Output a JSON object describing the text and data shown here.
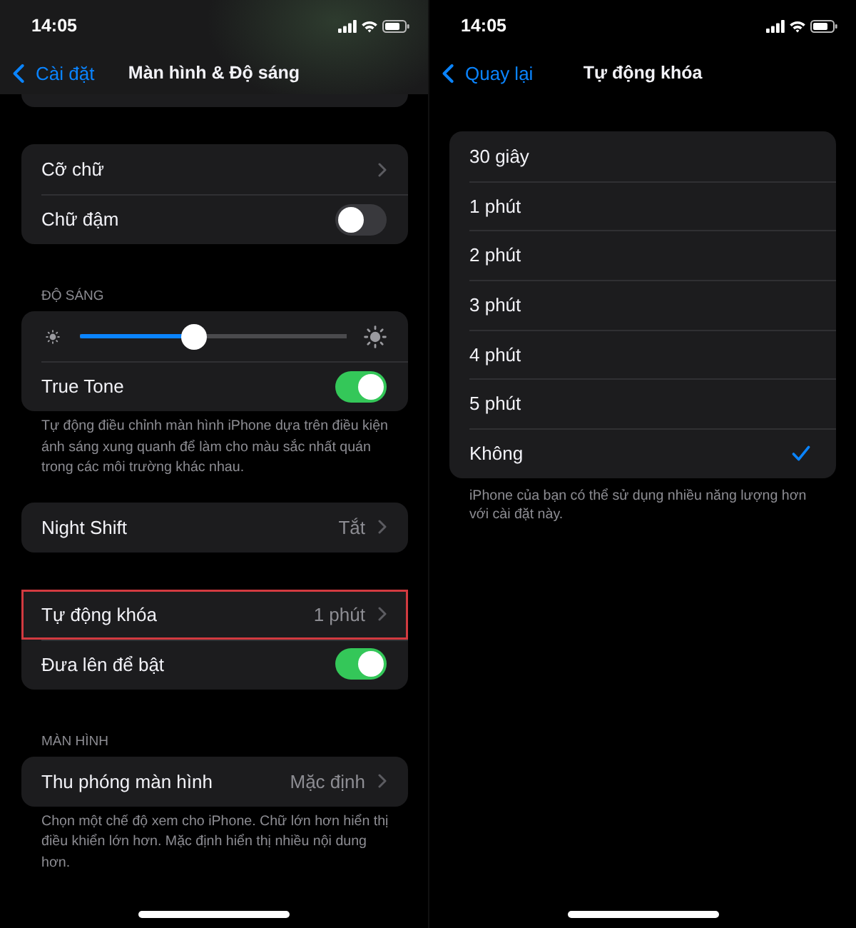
{
  "screens": [
    {
      "scrolled": true,
      "status_bar": {
        "time": "14:05"
      },
      "nav": {
        "back": "Cài đặt",
        "title": "Màn hình & Độ sáng"
      },
      "groups": [
        {
          "rows": [
            {
              "kind": "link",
              "label": "Cỡ chữ",
              "highlighted": false
            },
            {
              "kind": "toggle",
              "label": "Chữ đậm",
              "on": false,
              "highlighted": false
            }
          ]
        },
        {
          "header": "ĐỘ SÁNG",
          "rows": [
            {
              "kind": "slider",
              "level": 0.43,
              "highlighted": false
            },
            {
              "kind": "toggle",
              "label": "True Tone",
              "on": true,
              "highlighted": false
            }
          ],
          "footer": "Tự động điều chỉnh màn hình iPhone dựa trên điều kiện ánh sáng xung quanh để làm cho màu sắc nhất quán trong các môi trường khác nhau."
        },
        {
          "rows": [
            {
              "kind": "link",
              "label": "Night Shift",
              "value": "Tắt",
              "highlighted": false
            }
          ]
        },
        {
          "rows": [
            {
              "kind": "link",
              "label": "Tự động khóa",
              "value": "1 phút",
              "highlighted": true
            },
            {
              "kind": "toggle",
              "label": "Đưa lên để bật",
              "on": true,
              "highlighted": false
            }
          ]
        },
        {
          "header": "MÀN HÌNH",
          "rows": [
            {
              "kind": "link",
              "label": "Thu phóng màn hình",
              "value": "Mặc định",
              "highlighted": false
            }
          ],
          "footer": "Chọn một chế độ xem cho iPhone. Chữ lớn hơn hiển thị điều khiển lớn hơn. Mặc định hiển thị nhiều nội dung hơn."
        }
      ]
    },
    {
      "scrolled": false,
      "status_bar": {
        "time": "14:05"
      },
      "nav": {
        "back": "Quay lại",
        "title": "Tự động khóa"
      },
      "groups": [
        {
          "rows": [
            {
              "kind": "option",
              "label": "30 giây",
              "selected": false
            },
            {
              "kind": "option",
              "label": "1 phút",
              "selected": false
            },
            {
              "kind": "option",
              "label": "2 phút",
              "selected": false
            },
            {
              "kind": "option",
              "label": "3 phút",
              "selected": false
            },
            {
              "kind": "option",
              "label": "4 phút",
              "selected": false
            },
            {
              "kind": "option",
              "label": "5 phút",
              "selected": false
            },
            {
              "kind": "option",
              "label": "Không",
              "selected": true
            }
          ],
          "footer": "iPhone của bạn có thể sử dụng nhiều năng lượng hơn với cài đặt này."
        }
      ]
    }
  ]
}
